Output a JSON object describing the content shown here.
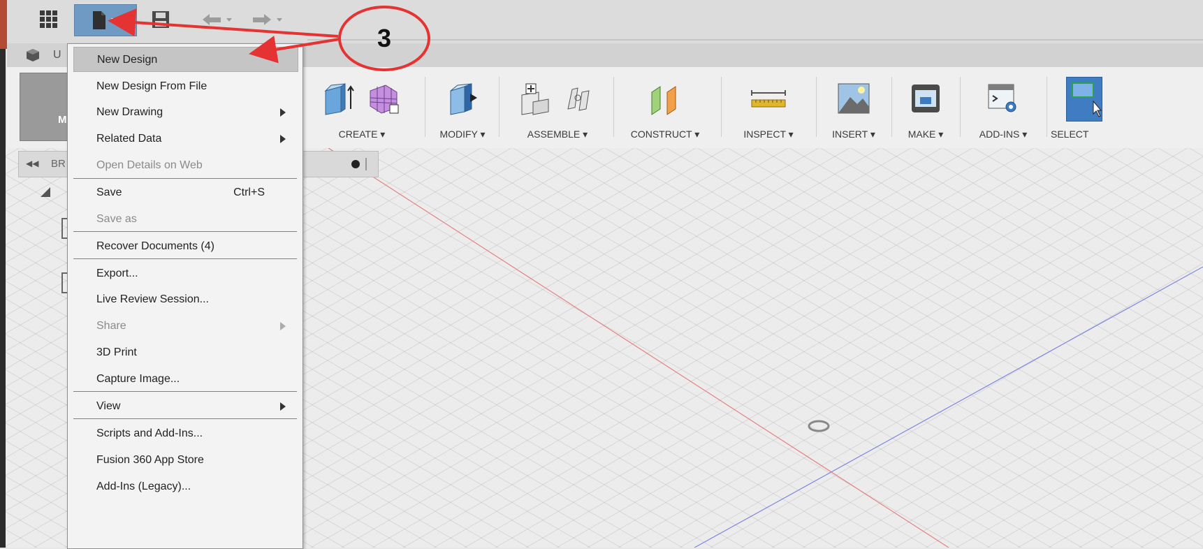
{
  "topbar": {
    "icons": [
      "app-grid-icon",
      "file-icon",
      "save-icon",
      "undo-icon",
      "redo-icon"
    ]
  },
  "tabrow": {
    "label": "U"
  },
  "ribbon": {
    "workspace_label": "M",
    "groups": [
      {
        "label": "CREATE ▾"
      },
      {
        "label": "MODIFY ▾"
      },
      {
        "label": "ASSEMBLE ▾"
      },
      {
        "label": "CONSTRUCT ▾"
      },
      {
        "label": "INSPECT ▾"
      },
      {
        "label": "INSERT ▾"
      },
      {
        "label": "MAKE ▾"
      },
      {
        "label": "ADD-INS ▾"
      },
      {
        "label": "SELECT"
      }
    ]
  },
  "browser": {
    "label": "BR"
  },
  "menu": {
    "items": [
      {
        "label": "New Design"
      },
      {
        "label": "New Design From File"
      },
      {
        "label": "New Drawing"
      },
      {
        "label": "Related Data"
      },
      {
        "label": "Open Details on Web"
      },
      {
        "label": "Save",
        "shortcut": "Ctrl+S"
      },
      {
        "label": "Save as"
      },
      {
        "label": "Recover Documents (4)"
      },
      {
        "label": "Export..."
      },
      {
        "label": "Live Review Session..."
      },
      {
        "label": "Share"
      },
      {
        "label": "3D Print"
      },
      {
        "label": "Capture Image..."
      },
      {
        "label": "View"
      },
      {
        "label": "Scripts and Add-Ins..."
      },
      {
        "label": "Fusion 360 App Store"
      },
      {
        "label": "Add-Ins (Legacy)..."
      }
    ]
  },
  "annotation": {
    "number": "3",
    "color": "#e53232"
  },
  "colors": {
    "file_button": "#6e9ac3",
    "x_axis": "#e58080",
    "y_axis": "#7f86e0",
    "accent": "#b44934"
  }
}
